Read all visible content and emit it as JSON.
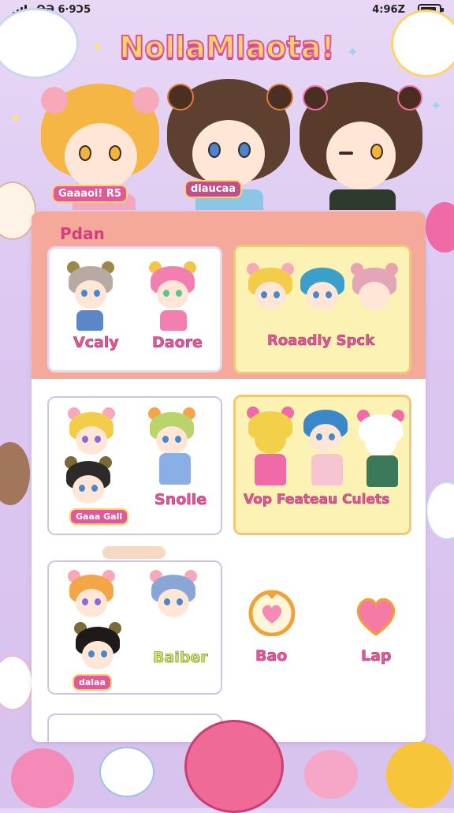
{
  "status": {
    "left_text": "ꝊƏ 6·9Ɔ5",
    "right_text": "4:96Z",
    "battery_level": 0.85
  },
  "app": {
    "title": "NollaMlaota!"
  },
  "hero": {
    "tags": [
      "Gaaaoi! R5",
      "dlaucaa"
    ]
  },
  "panel": {
    "label": "Pdan",
    "cards": [
      {
        "labels": [
          "Vcaly",
          "Daore"
        ]
      },
      {
        "labels": [
          "Roaadiy Spck"
        ]
      },
      {
        "labels": [
          "Snolle"
        ],
        "tag": "Gaaa Gall"
      },
      {
        "labels": [
          "Vop Feateau Culets"
        ]
      },
      {
        "labels": [
          "Baiber"
        ],
        "tag": "dalaa"
      },
      {
        "labels": [
          "Bao",
          "Lap"
        ]
      }
    ]
  },
  "colors": {
    "accent_pink": "#e05a9a",
    "panel_salmon": "#f4a99a",
    "card_yellow": "#fbf2b3",
    "bg_lavender": "#dcc7f1"
  },
  "icons": [
    "signal-icon",
    "battery-icon",
    "heart-ring-icon",
    "heart-icon",
    "star-icon"
  ]
}
